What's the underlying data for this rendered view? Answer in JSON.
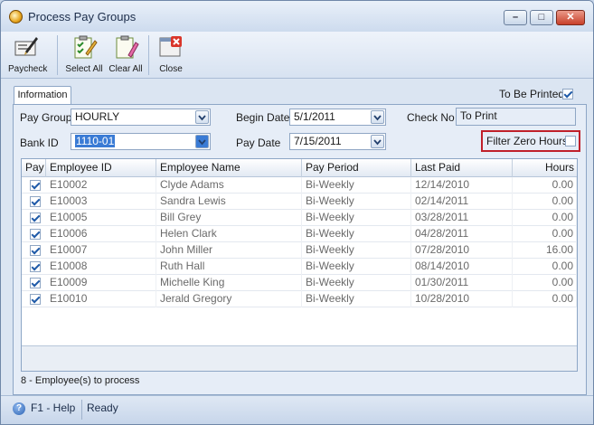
{
  "window": {
    "title": "Process Pay Groups"
  },
  "toolbar": {
    "paycheck": "Paycheck",
    "select_all": "Select All",
    "clear_all": "Clear All",
    "close": "Close"
  },
  "tabs": {
    "information": "Information"
  },
  "form": {
    "to_be_printed_label": "To Be Printed",
    "to_be_printed": true,
    "pay_group_label": "Pay Group",
    "pay_group": "HOURLY",
    "bank_id_label": "Bank ID",
    "bank_id": "1110-01",
    "begin_date_label": "Begin Date",
    "begin_date": "5/1/2011",
    "pay_date_label": "Pay Date",
    "pay_date": "7/15/2011",
    "check_no_label": "Check No",
    "check_no": "To Print",
    "filter_zero_label": "Filter Zero Hours",
    "filter_zero": false
  },
  "grid": {
    "columns": [
      "Pay",
      "Employee ID",
      "Employee Name",
      "Pay Period",
      "Last Paid",
      "Hours"
    ],
    "rows": [
      {
        "pay": true,
        "id": "E10002",
        "name": "Clyde Adams",
        "period": "Bi-Weekly",
        "last_paid": "12/14/2010",
        "hours": "0.00"
      },
      {
        "pay": true,
        "id": "E10003",
        "name": "Sandra Lewis",
        "period": "Bi-Weekly",
        "last_paid": "02/14/2011",
        "hours": "0.00"
      },
      {
        "pay": true,
        "id": "E10005",
        "name": "Bill Grey",
        "period": "Bi-Weekly",
        "last_paid": "03/28/2011",
        "hours": "0.00"
      },
      {
        "pay": true,
        "id": "E10006",
        "name": "Helen Clark",
        "period": "Bi-Weekly",
        "last_paid": "04/28/2011",
        "hours": "0.00"
      },
      {
        "pay": true,
        "id": "E10007",
        "name": "John Miller",
        "period": "Bi-Weekly",
        "last_paid": "07/28/2010",
        "hours": "16.00"
      },
      {
        "pay": true,
        "id": "E10008",
        "name": "Ruth Hall",
        "period": "Bi-Weekly",
        "last_paid": "08/14/2010",
        "hours": "0.00"
      },
      {
        "pay": true,
        "id": "E10009",
        "name": "Michelle King",
        "period": "Bi-Weekly",
        "last_paid": "01/30/2011",
        "hours": "0.00"
      },
      {
        "pay": true,
        "id": "E10010",
        "name": "Jerald Gregory",
        "period": "Bi-Weekly",
        "last_paid": "10/28/2010",
        "hours": "0.00"
      }
    ]
  },
  "summary": "8 - Employee(s) to process",
  "statusbar": {
    "help": "F1 - Help",
    "status": "Ready"
  },
  "colors": {
    "accent": "#3a7bd5",
    "highlight_border": "#c0202a"
  }
}
